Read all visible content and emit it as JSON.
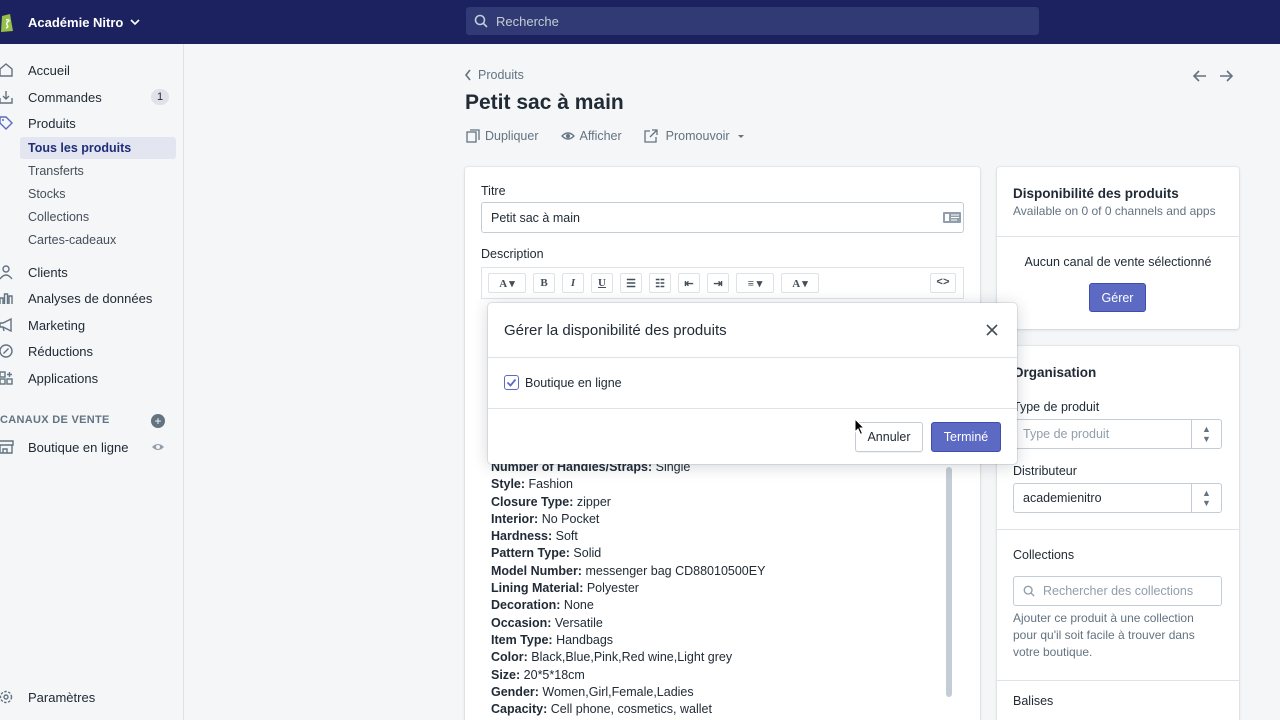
{
  "topbar": {
    "store_name": "Académie Nitro",
    "search_placeholder": "Recherche"
  },
  "sidebar": {
    "items": [
      {
        "label": "Accueil"
      },
      {
        "label": "Commandes",
        "badge": "1"
      },
      {
        "label": "Produits"
      },
      {
        "label": "Clients"
      },
      {
        "label": "Analyses de données"
      },
      {
        "label": "Marketing"
      },
      {
        "label": "Réductions"
      },
      {
        "label": "Applications"
      }
    ],
    "sub_items": [
      "Tous les produits",
      "Transferts",
      "Stocks",
      "Collections",
      "Cartes-cadeaux"
    ],
    "sales_channels_heading": "CANAUX DE VENTE",
    "online_store": "Boutique en ligne",
    "settings": "Paramètres"
  },
  "page": {
    "back_label": "Produits",
    "title": "Petit sac à main",
    "actions": [
      "Dupliquer",
      "Afficher",
      "Promouvoir"
    ]
  },
  "product_form": {
    "title_label": "Titre",
    "title_value": "Petit sac à main",
    "description_label": "Description",
    "description_lines": [
      {
        "key": "Number of Handles/Straps:",
        "value": " Single"
      },
      {
        "key": "Style:",
        "value": " Fashion"
      },
      {
        "key": "Closure Type:",
        "value": " zipper"
      },
      {
        "key": "Interior:",
        "value": " No Pocket"
      },
      {
        "key": "Hardness:",
        "value": " Soft"
      },
      {
        "key": "Pattern Type:",
        "value": " Solid"
      },
      {
        "key": "Model Number:",
        "value": " messenger bag CD88010500EY"
      },
      {
        "key": "Lining Material:",
        "value": " Polyester"
      },
      {
        "key": "Decoration:",
        "value": " None"
      },
      {
        "key": "Occasion:",
        "value": " Versatile"
      },
      {
        "key": "Item Type:",
        "value": " Handbags"
      },
      {
        "key": "Color:",
        "value": " Black,Blue,Pink,Red wine,Light grey"
      },
      {
        "key": "Size:",
        "value": " 20*5*18cm"
      },
      {
        "key": "Gender:",
        "value": " Women,Girl,Female,Ladies"
      },
      {
        "key": "Capacity:",
        "value": " Cell phone, cosmetics, wallet"
      }
    ]
  },
  "availability": {
    "title": "Disponibilité des produits",
    "subtitle": "Available on 0 of 0 channels and apps",
    "empty_text": "Aucun canal de vente sélectionné",
    "manage_button": "Gérer"
  },
  "organisation": {
    "title": "Organisation",
    "product_type_label": "Type de produit",
    "product_type_placeholder": "Type de produit",
    "vendor_label": "Distributeur",
    "vendor_value": "academienitro",
    "collections_label": "Collections",
    "collections_placeholder": "Rechercher des collections",
    "collections_help": "Ajouter ce produit à une collection pour qu'il soit facile à trouver dans votre boutique.",
    "tags_label": "Balises"
  },
  "modal": {
    "title": "Gérer la disponibilité des produits",
    "channel_label": "Boutique en ligne",
    "channel_checked": true,
    "cancel_label": "Annuler",
    "done_label": "Terminé"
  },
  "colors": {
    "topbar": "#1c2260",
    "primary": "#5c6ac4",
    "active_nav": "#202e78"
  }
}
